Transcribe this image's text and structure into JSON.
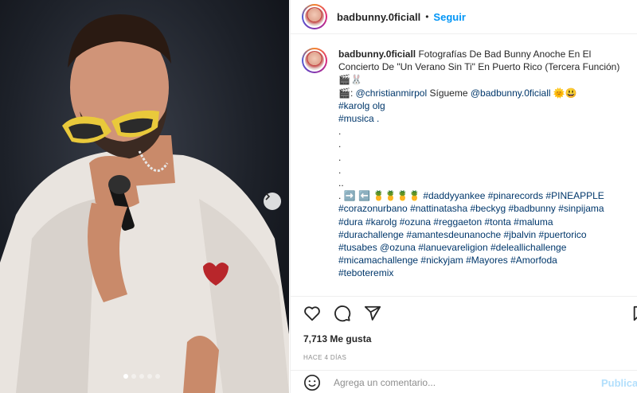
{
  "header": {
    "username": "badbunny.0ficiall",
    "separator": "•",
    "follow_label": "Seguir"
  },
  "caption": {
    "username": "badbunny.0ficiall",
    "line1": "Fotografías De Bad Bunny Anoche En El",
    "line2": "Concierto De \"Un Verano Sin Ti\" En Puerto Rico (Tercera Función)",
    "line3": "🎬🐰",
    "line4_prefix": "🎬: ",
    "line4_mention": "@christianmirpol",
    "line4_mid": " Sígueme ",
    "line4_mention2": "@badbunny.0ficiall",
    "line4_emoji": " 🌞😃",
    "line5": "#karolg olg",
    "line6": "#musica .",
    "dot_lines": [
      ".",
      ".",
      ".",
      ".",
      ".."
    ],
    "line7_prefix": ". ➡️ ⬅️ 🍍🍍🍍🍍 ",
    "hashtag_lines": [
      "#daddyyankee #pinarecords #PINEAPPLE",
      "#corazonurbano #nattinatasha #beckyg #badbunny #sinpijama",
      "#dura #karolg #ozuna #reggaeton #tonta  #maluma",
      "#durachallenge #amantesdeunanoche  #jbalvin #puertorico",
      "#tusabes @ozuna #lanuevareligion #deleallichallenge",
      "#micamachallenge #nickyjam #Mayores #Amorfoda",
      "#teboteremix"
    ]
  },
  "icons": [
    "heart-icon",
    "comment-icon",
    "share-icon",
    "bookmark-icon",
    "emoji-icon",
    "chevron-right-icon"
  ],
  "likes": "7,713 Me gusta",
  "date": "HACE 4 DÍAS",
  "comment": {
    "placeholder": "Agrega un comentario...",
    "post_label": "Publicar"
  },
  "carousel": {
    "total": 5,
    "active": 1
  },
  "colors": {
    "link": "#00376b",
    "follow": "#0095f6",
    "post_disabled": "#b2dffc",
    "border": "#efefef"
  }
}
